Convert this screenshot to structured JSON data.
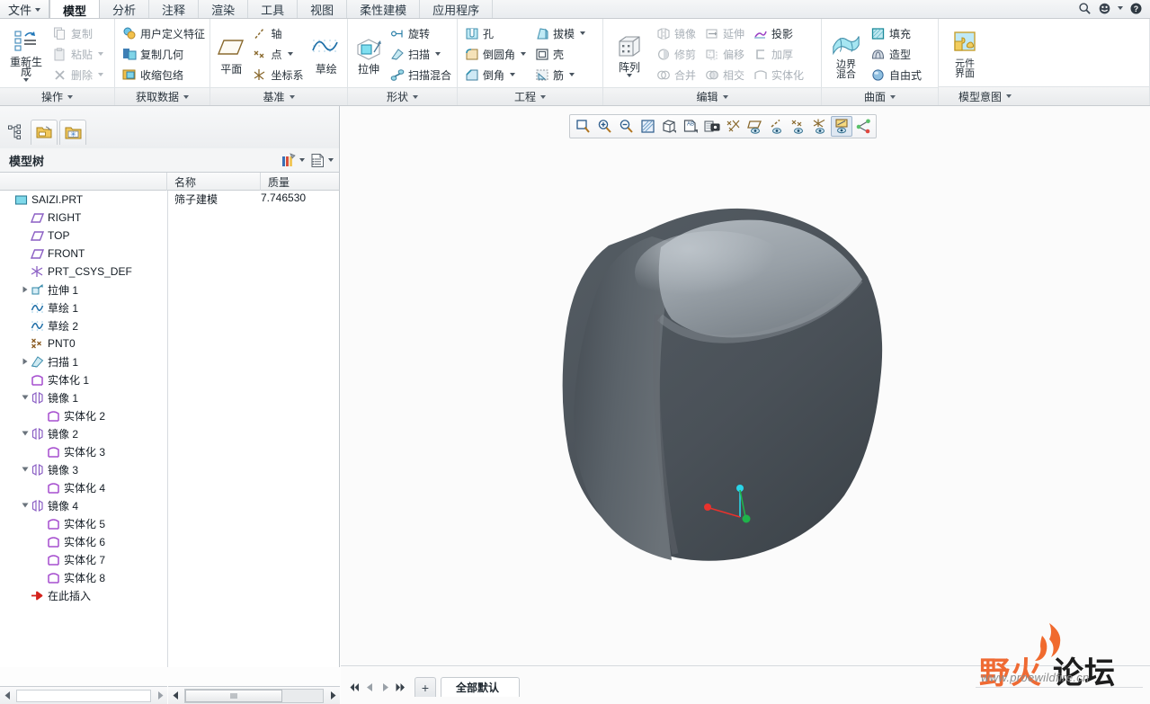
{
  "window": {
    "file_menu": "文件",
    "tabs": [
      {
        "label": "模型",
        "active": true
      },
      {
        "label": "分析",
        "active": false
      },
      {
        "label": "注释",
        "active": false
      },
      {
        "label": "渲染",
        "active": false
      },
      {
        "label": "工具",
        "active": false
      },
      {
        "label": "视图",
        "active": false
      },
      {
        "label": "柔性建模",
        "active": false
      },
      {
        "label": "应用程序",
        "active": false
      }
    ],
    "topright_icons": [
      "search-icon",
      "account-icon",
      "help-icon"
    ]
  },
  "ribbon": {
    "groups": [
      {
        "label": "操作",
        "big": [
          {
            "label": "重新生成",
            "icon": "regenerate-icon",
            "dropdown": true
          }
        ],
        "small": [
          {
            "label": "复制",
            "icon": "copy-icon",
            "disabled": true,
            "dropdown": false
          },
          {
            "label": "粘贴",
            "icon": "paste-icon",
            "disabled": true,
            "dropdown": true
          },
          {
            "label": "删除",
            "icon": "delete-icon",
            "disabled": true,
            "dropdown": true
          }
        ]
      },
      {
        "label": "获取数据",
        "big": [],
        "small": [
          {
            "label": "用户定义特征",
            "icon": "udf-icon",
            "disabled": false,
            "dropdown": false
          },
          {
            "label": "复制几何",
            "icon": "copy-geometry-icon",
            "disabled": false,
            "dropdown": false
          },
          {
            "label": "收缩包络",
            "icon": "shrinkwrap-icon",
            "disabled": false,
            "dropdown": false
          }
        ]
      },
      {
        "label": "基准",
        "big": [
          {
            "label": "平面",
            "icon": "datum-plane-icon",
            "dropdown": false
          }
        ],
        "small": [
          {
            "label": "轴",
            "icon": "datum-axis-icon",
            "disabled": false,
            "dropdown": false
          },
          {
            "label": "点",
            "icon": "datum-point-icon",
            "disabled": false,
            "dropdown": true
          },
          {
            "label": "坐标系",
            "icon": "coordinate-system-icon",
            "disabled": false,
            "dropdown": false
          }
        ],
        "big2": [
          {
            "label": "草绘",
            "icon": "sketch-icon",
            "dropdown": false
          }
        ]
      },
      {
        "label": "形状",
        "big": [
          {
            "label": "拉伸",
            "icon": "extrude-icon",
            "dropdown": false
          }
        ],
        "small": [
          {
            "label": "旋转",
            "icon": "revolve-icon",
            "disabled": false,
            "dropdown": false
          },
          {
            "label": "扫描",
            "icon": "sweep-icon",
            "disabled": false,
            "dropdown": true
          },
          {
            "label": "扫描混合",
            "icon": "swept-blend-icon",
            "disabled": false,
            "dropdown": false
          }
        ]
      },
      {
        "label": "工程",
        "big": [],
        "small": [
          {
            "label": "孔",
            "icon": "hole-icon",
            "disabled": false,
            "dropdown": false
          },
          {
            "label": "倒圆角",
            "icon": "round-icon",
            "disabled": false,
            "dropdown": true
          },
          {
            "label": "倒角",
            "icon": "chamfer-icon",
            "disabled": false,
            "dropdown": true
          }
        ],
        "small2": [
          {
            "label": "拔模",
            "icon": "draft-icon",
            "disabled": false,
            "dropdown": true
          },
          {
            "label": "壳",
            "icon": "shell-icon",
            "disabled": false,
            "dropdown": false
          },
          {
            "label": "筋",
            "icon": "rib-icon",
            "disabled": false,
            "dropdown": true
          }
        ]
      },
      {
        "label": "编辑",
        "big": [
          {
            "label": "阵列",
            "icon": "pattern-icon",
            "dropdown": true
          }
        ],
        "small": [
          {
            "label": "镜像",
            "icon": "mirror-icon",
            "disabled": true,
            "dropdown": false
          },
          {
            "label": "修剪",
            "icon": "trim-icon",
            "disabled": true,
            "dropdown": false
          },
          {
            "label": "合并",
            "icon": "merge-icon",
            "disabled": true,
            "dropdown": false
          }
        ],
        "small2": [
          {
            "label": "延伸",
            "icon": "extend-icon",
            "disabled": true,
            "dropdown": false
          },
          {
            "label": "偏移",
            "icon": "offset-icon",
            "disabled": true,
            "dropdown": false
          },
          {
            "label": "相交",
            "icon": "intersect-icon",
            "disabled": true,
            "dropdown": false
          }
        ],
        "small3": [
          {
            "label": "投影",
            "icon": "project-icon",
            "disabled": false,
            "dropdown": false
          },
          {
            "label": "加厚",
            "icon": "thicken-icon",
            "disabled": true,
            "dropdown": false
          },
          {
            "label": "实体化",
            "icon": "solidify-icon",
            "disabled": true,
            "dropdown": false
          }
        ]
      },
      {
        "label": "曲面",
        "big": [
          {
            "label": "边界混合",
            "icon": "boundary-blend-icon",
            "dropdown": false
          }
        ],
        "small": [
          {
            "label": "填充",
            "icon": "fill-icon",
            "disabled": false,
            "dropdown": false
          },
          {
            "label": "造型",
            "icon": "style-icon",
            "disabled": false,
            "dropdown": false
          },
          {
            "label": "自由式",
            "icon": "freestyle-icon",
            "disabled": false,
            "dropdown": false
          }
        ]
      },
      {
        "label": "模型意图",
        "big": [
          {
            "label": "元件界面",
            "icon": "component-interface-icon",
            "dropdown": false
          }
        ],
        "small": []
      }
    ]
  },
  "left_panel": {
    "nav_tabs": [
      "model-tree-icon",
      "folder-browser-icon",
      "favorites-icon"
    ],
    "tree_title": "模型树",
    "tree_tools": [
      "filter-settings-icon",
      "tree-columns-icon"
    ],
    "columns": [
      "",
      "名称",
      "质量"
    ],
    "root_meta": {
      "name": "筛子建模",
      "mass": "7.746530"
    },
    "tree": [
      {
        "label": "SAIZI.PRT",
        "icon": "part-icon",
        "indent": 0,
        "toggle": "none"
      },
      {
        "label": "RIGHT",
        "icon": "datum-plane-icon",
        "indent": 1,
        "toggle": "none"
      },
      {
        "label": "TOP",
        "icon": "datum-plane-icon",
        "indent": 1,
        "toggle": "none"
      },
      {
        "label": "FRONT",
        "icon": "datum-plane-icon",
        "indent": 1,
        "toggle": "none"
      },
      {
        "label": "PRT_CSYS_DEF",
        "icon": "csys-icon",
        "indent": 1,
        "toggle": "none"
      },
      {
        "label": "拉伸 1",
        "icon": "extrude-icon",
        "indent": 1,
        "toggle": "collapsed"
      },
      {
        "label": "草绘 1",
        "icon": "sketch-icon",
        "indent": 1,
        "toggle": "none"
      },
      {
        "label": "草绘 2",
        "icon": "sketch-icon",
        "indent": 1,
        "toggle": "none"
      },
      {
        "label": "PNT0",
        "icon": "point-icon",
        "indent": 1,
        "toggle": "none"
      },
      {
        "label": "扫描 1",
        "icon": "sweep-icon",
        "indent": 1,
        "toggle": "collapsed"
      },
      {
        "label": "实体化 1",
        "icon": "solidify-icon",
        "indent": 1,
        "toggle": "none"
      },
      {
        "label": "镜像 1",
        "icon": "mirror-icon",
        "indent": 1,
        "toggle": "expanded"
      },
      {
        "label": "实体化 2",
        "icon": "solidify-icon",
        "indent": 2,
        "toggle": "none"
      },
      {
        "label": "镜像 2",
        "icon": "mirror-icon",
        "indent": 1,
        "toggle": "expanded"
      },
      {
        "label": "实体化 3",
        "icon": "solidify-icon",
        "indent": 2,
        "toggle": "none"
      },
      {
        "label": "镜像 3",
        "icon": "mirror-icon",
        "indent": 1,
        "toggle": "expanded"
      },
      {
        "label": "实体化 4",
        "icon": "solidify-icon",
        "indent": 2,
        "toggle": "none"
      },
      {
        "label": "镜像 4",
        "icon": "mirror-icon",
        "indent": 1,
        "toggle": "expanded"
      },
      {
        "label": "实体化 5",
        "icon": "solidify-icon",
        "indent": 2,
        "toggle": "none"
      },
      {
        "label": "实体化 6",
        "icon": "solidify-icon",
        "indent": 2,
        "toggle": "none"
      },
      {
        "label": "实体化 7",
        "icon": "solidify-icon",
        "indent": 2,
        "toggle": "none"
      },
      {
        "label": "实体化 8",
        "icon": "solidify-icon",
        "indent": 2,
        "toggle": "none"
      },
      {
        "label": "在此插入",
        "icon": "insert-here-icon",
        "indent": 1,
        "toggle": "none"
      }
    ]
  },
  "graphics_toolbar": {
    "buttons": [
      "refit-icon",
      "zoom-in-icon",
      "zoom-out-icon",
      "repaint-icon",
      "display-style-icon",
      "saved-views-icon",
      "capture-image-icon",
      "datum-display-all-icon",
      "plane-display-icon",
      "axis-display-icon",
      "point-display-icon",
      "csys-display-icon",
      "annotation-display-icon",
      "spin-center-icon"
    ],
    "selected": "annotation-display-icon"
  },
  "bottom_bar": {
    "nav": [
      "first-icon",
      "previous-icon",
      "next-icon",
      "last-icon"
    ],
    "add_label": "+",
    "active_tab": "全部默认"
  },
  "watermark": {
    "text_left": "野火",
    "text_right": "论坛",
    "url": "www.proewildfire.cn",
    "accent": "#ef6a33"
  },
  "viewport": {
    "csys": {
      "x_axis_color": "#e8322d",
      "y_axis_color": "#1fb34a",
      "z_axis_color": "#2ad4e8"
    },
    "model_light": "#9aa2a9",
    "model_dark": "#4e555c",
    "background": "#fbfbfb"
  }
}
